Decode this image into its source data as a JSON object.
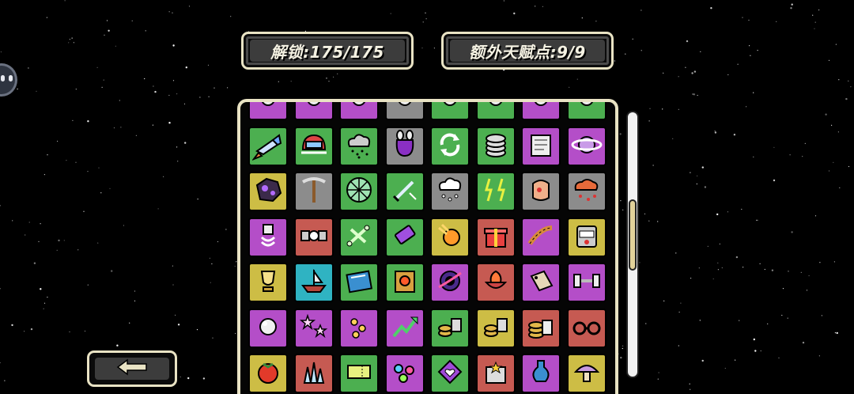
{
  "header": {
    "unlock_label": "解锁:175/175",
    "talent_label": "额外天赋点:9/9"
  },
  "colors": {
    "background": "#000000",
    "panel_border": "#e9e3c4",
    "label_bg": "#3c3c3c",
    "tile_green": "#4caf50",
    "tile_purple": "#b44ec8",
    "tile_gray": "#8c8c8c",
    "tile_yellow": "#cdbd45",
    "tile_red": "#c65a52",
    "tile_teal": "#2fb3c2",
    "scroll_thumb": "#e2d29a"
  },
  "scroll": {
    "position_fraction": 0.45,
    "thumb_fraction": 0.27
  },
  "back_button": {
    "icon": "arrow-left-icon"
  },
  "items": {
    "rows": [
      [
        {
          "color": "purple",
          "icon": "partial-icon"
        },
        {
          "color": "purple",
          "icon": "partial-icon"
        },
        {
          "color": "purple",
          "icon": "partial-icon"
        },
        {
          "color": "gray",
          "icon": "partial-icon"
        },
        {
          "color": "green",
          "icon": "partial-icon"
        },
        {
          "color": "green",
          "icon": "partial-icon"
        },
        {
          "color": "purple",
          "icon": "partial-icon"
        },
        {
          "color": "green",
          "icon": "partial-icon"
        }
      ],
      [
        {
          "color": "green",
          "icon": "thruster-icon"
        },
        {
          "color": "green",
          "icon": "helmet-icon"
        },
        {
          "color": "green",
          "icon": "rain-cloud-icon"
        },
        {
          "color": "gray",
          "icon": "pouch-icon"
        },
        {
          "color": "green",
          "icon": "recycle-icon"
        },
        {
          "color": "green",
          "icon": "coin-stack-icon"
        },
        {
          "color": "purple",
          "icon": "scroll-icon"
        },
        {
          "color": "purple",
          "icon": "planet-icon"
        }
      ],
      [
        {
          "color": "yellow",
          "icon": "asteroid-icon"
        },
        {
          "color": "gray",
          "icon": "pickaxe-icon"
        },
        {
          "color": "green",
          "icon": "web-icon"
        },
        {
          "color": "green",
          "icon": "sword-icon"
        },
        {
          "color": "gray",
          "icon": "snow-cloud-icon"
        },
        {
          "color": "green",
          "icon": "lightning-icon"
        },
        {
          "color": "gray",
          "icon": "flesh-icon"
        },
        {
          "color": "gray",
          "icon": "blood-cloud-icon"
        }
      ],
      [
        {
          "color": "purple",
          "icon": "bolt-icon"
        },
        {
          "color": "red",
          "icon": "satellite-icon"
        },
        {
          "color": "green",
          "icon": "bones-icon"
        },
        {
          "color": "green",
          "icon": "battery-icon"
        },
        {
          "color": "yellow",
          "icon": "fireball-icon"
        },
        {
          "color": "red",
          "icon": "gift-icon"
        },
        {
          "color": "purple",
          "icon": "rope-icon"
        },
        {
          "color": "yellow",
          "icon": "slot-machine-icon"
        }
      ],
      [
        {
          "color": "yellow",
          "icon": "trophy-icon"
        },
        {
          "color": "teal",
          "icon": "boat-icon"
        },
        {
          "color": "green",
          "icon": "book-icon"
        },
        {
          "color": "green",
          "icon": "spellbook-icon"
        },
        {
          "color": "purple",
          "icon": "black-hole-icon"
        },
        {
          "color": "red",
          "icon": "flame-bowl-icon"
        },
        {
          "color": "purple",
          "icon": "tag-icon"
        },
        {
          "color": "purple",
          "icon": "dumbbell-icon"
        }
      ],
      [
        {
          "color": "purple",
          "icon": "pearl-icon"
        },
        {
          "color": "purple",
          "icon": "stars-icon"
        },
        {
          "color": "purple",
          "icon": "meteor-icon"
        },
        {
          "color": "purple",
          "icon": "growth-arrow-icon"
        },
        {
          "color": "green",
          "icon": "coin-bag-icon"
        },
        {
          "color": "yellow",
          "icon": "coin-bag-icon"
        },
        {
          "color": "red",
          "icon": "coin-pile-icon"
        },
        {
          "color": "red",
          "icon": "glasses-icon"
        }
      ],
      [
        {
          "color": "yellow",
          "icon": "tomato-icon"
        },
        {
          "color": "red",
          "icon": "crystal-icon"
        },
        {
          "color": "green",
          "icon": "ticket-icon"
        },
        {
          "color": "purple",
          "icon": "gems-icon"
        },
        {
          "color": "green",
          "icon": "heart-badge-icon"
        },
        {
          "color": "red",
          "icon": "star-box-icon"
        },
        {
          "color": "purple",
          "icon": "potion-icon"
        },
        {
          "color": "yellow",
          "icon": "mushroom-icon"
        }
      ]
    ]
  }
}
